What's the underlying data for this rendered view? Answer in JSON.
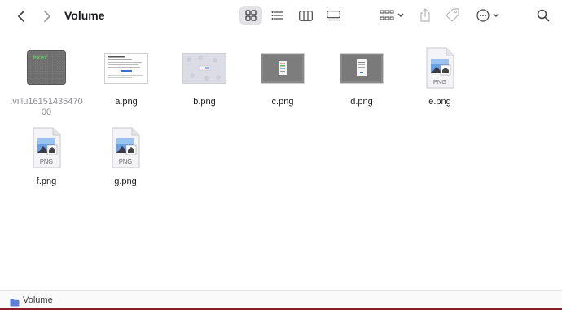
{
  "window": {
    "title": "Volume"
  },
  "toolbar": {
    "back_icon": "chevron-left-icon",
    "forward_icon": "chevron-right-icon",
    "view_icons": [
      "icon-view-grid",
      "list-view",
      "column-view",
      "gallery-view"
    ],
    "group_icon": "group-by-icon",
    "share_icon": "share-icon",
    "tag_icon": "tag-icon",
    "more_icon": "ellipsis-circle-icon",
    "search_icon": "search-icon"
  },
  "files": [
    {
      "name": ".viilu1615143547000",
      "line1": ".viilu16151435470",
      "line2": "00",
      "kind": "exec",
      "badge": "exec"
    },
    {
      "name": "a.png",
      "kind": "screenshot-doc"
    },
    {
      "name": "b.png",
      "kind": "screenshot-light"
    },
    {
      "name": "c.png",
      "kind": "screenshot-dark"
    },
    {
      "name": "d.png",
      "kind": "screenshot-dialog"
    },
    {
      "name": "e.png",
      "kind": "png-icon",
      "badge": "PNG"
    },
    {
      "name": "f.png",
      "kind": "png-icon",
      "badge": "PNG"
    },
    {
      "name": "g.png",
      "kind": "png-icon",
      "badge": "PNG"
    }
  ],
  "statusbar": {
    "path_label": "Volume"
  },
  "colors": {
    "accent_folder": "#5b7fd6",
    "edge": "#8b1a2a"
  }
}
